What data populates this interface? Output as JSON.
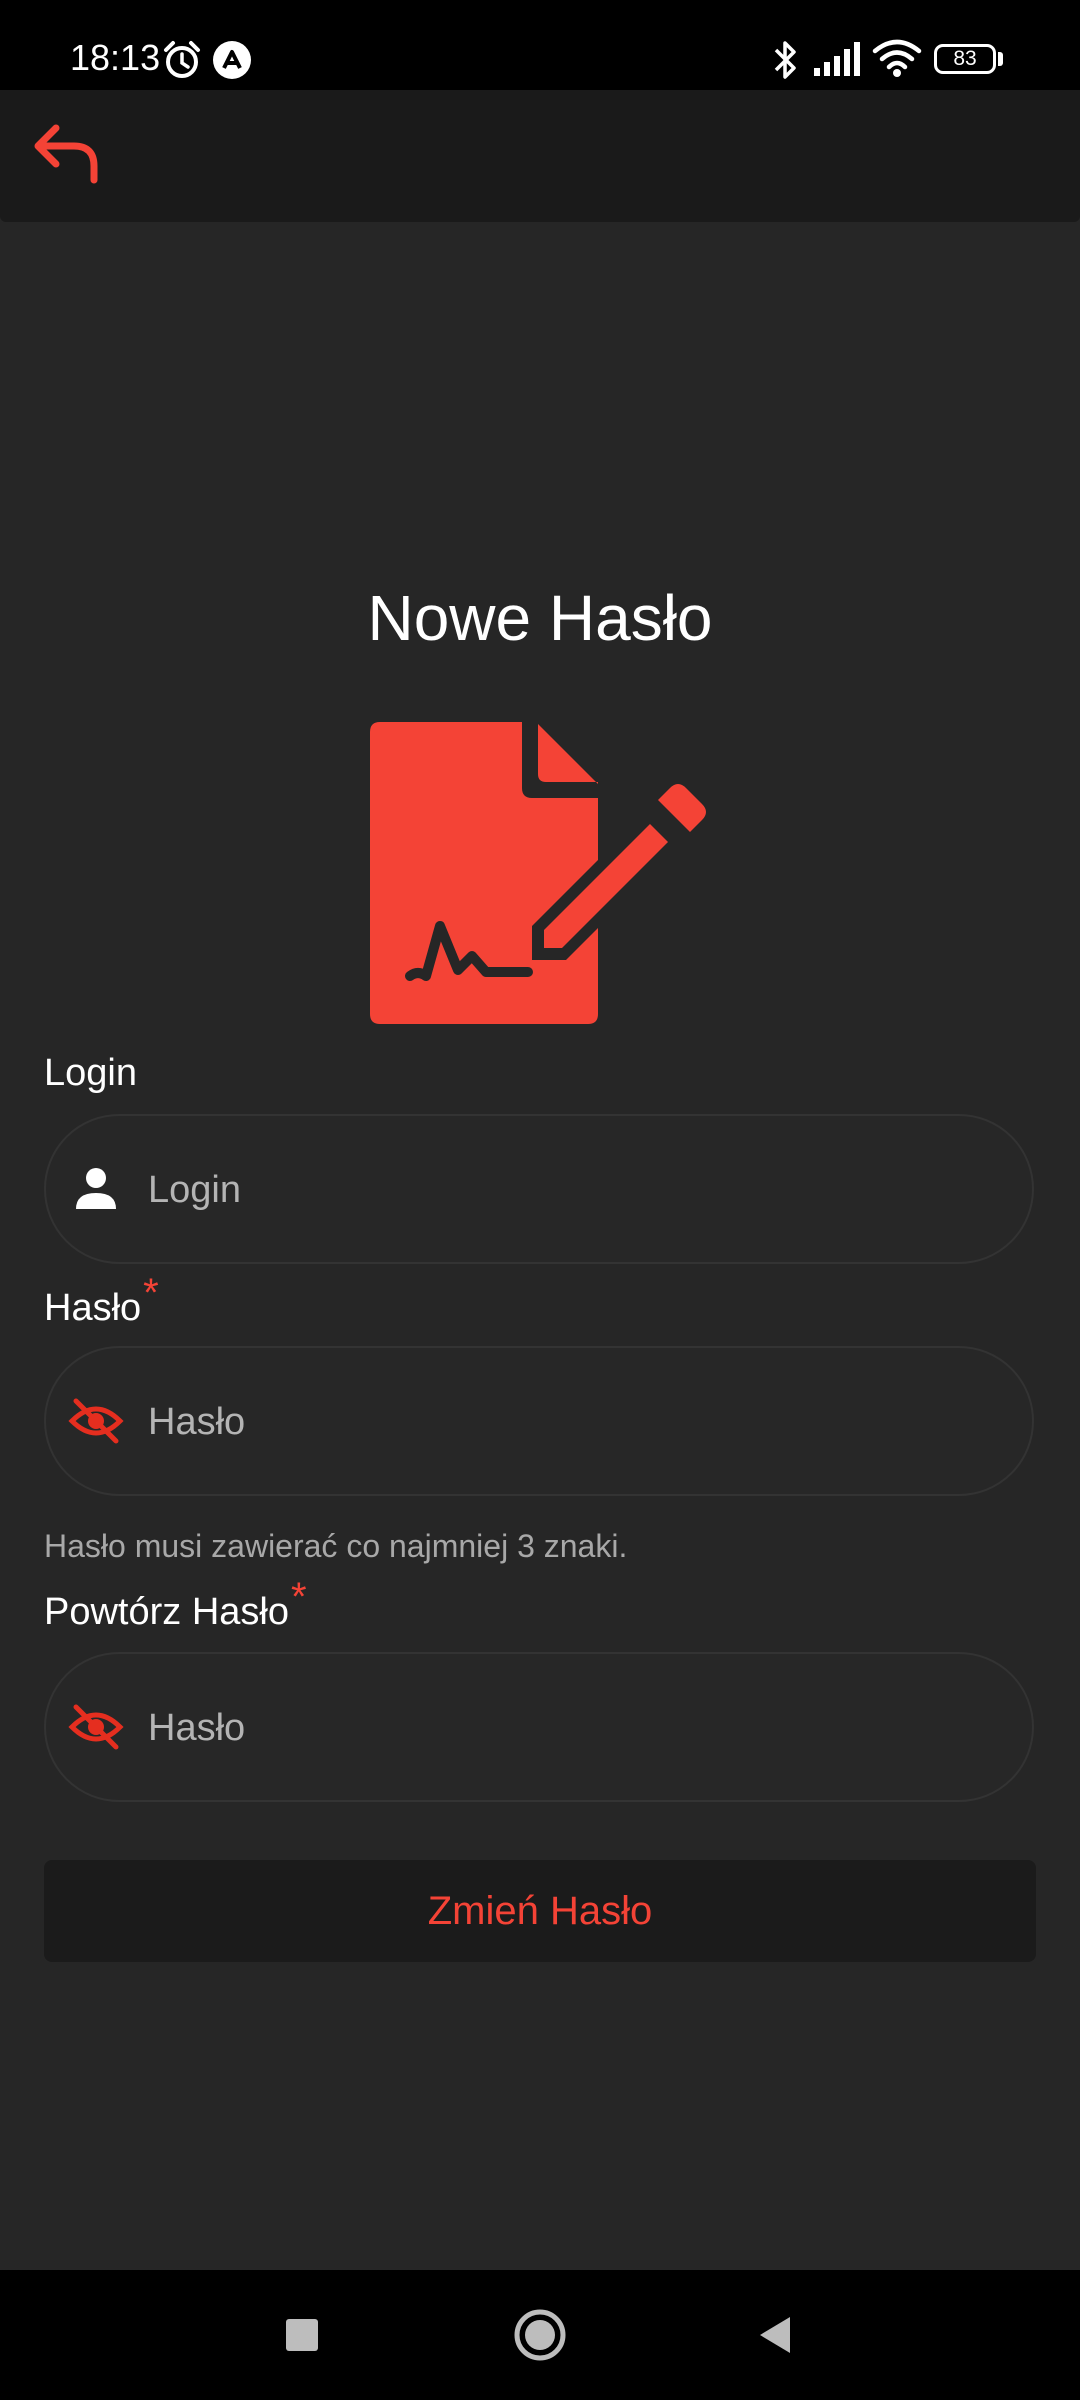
{
  "status_bar": {
    "time": "18:13",
    "battery": "83",
    "icons": [
      "alarm-icon",
      "app-notification-icon",
      "bluetooth-icon",
      "signal-icon",
      "wifi-icon",
      "battery-icon"
    ]
  },
  "header": {
    "back_icon": "back-arrow-icon"
  },
  "main": {
    "title": "Nowe Hasło",
    "hero_icon": "file-signature-icon",
    "login": {
      "label": "Login",
      "placeholder": "Login",
      "value": "",
      "icon": "user-icon"
    },
    "password": {
      "label": "Hasło",
      "required_mark": "*",
      "placeholder": "Hasło",
      "value": "",
      "icon": "eye-off-icon",
      "hint": "Hasło musi zawierać co najmniej 3 znaki."
    },
    "repeat_password": {
      "label": "Powtórz Hasło",
      "required_mark": "*",
      "placeholder": "Hasło",
      "value": "",
      "icon": "eye-off-icon"
    },
    "submit_label": "Zmień Hasło"
  },
  "nav_bar": {
    "buttons": [
      "recents-button",
      "home-button",
      "back-button"
    ]
  },
  "colors": {
    "accent": "#f44336",
    "background": "#262626",
    "header": "#1a1a1a",
    "button_bg": "#1b1b1b"
  }
}
